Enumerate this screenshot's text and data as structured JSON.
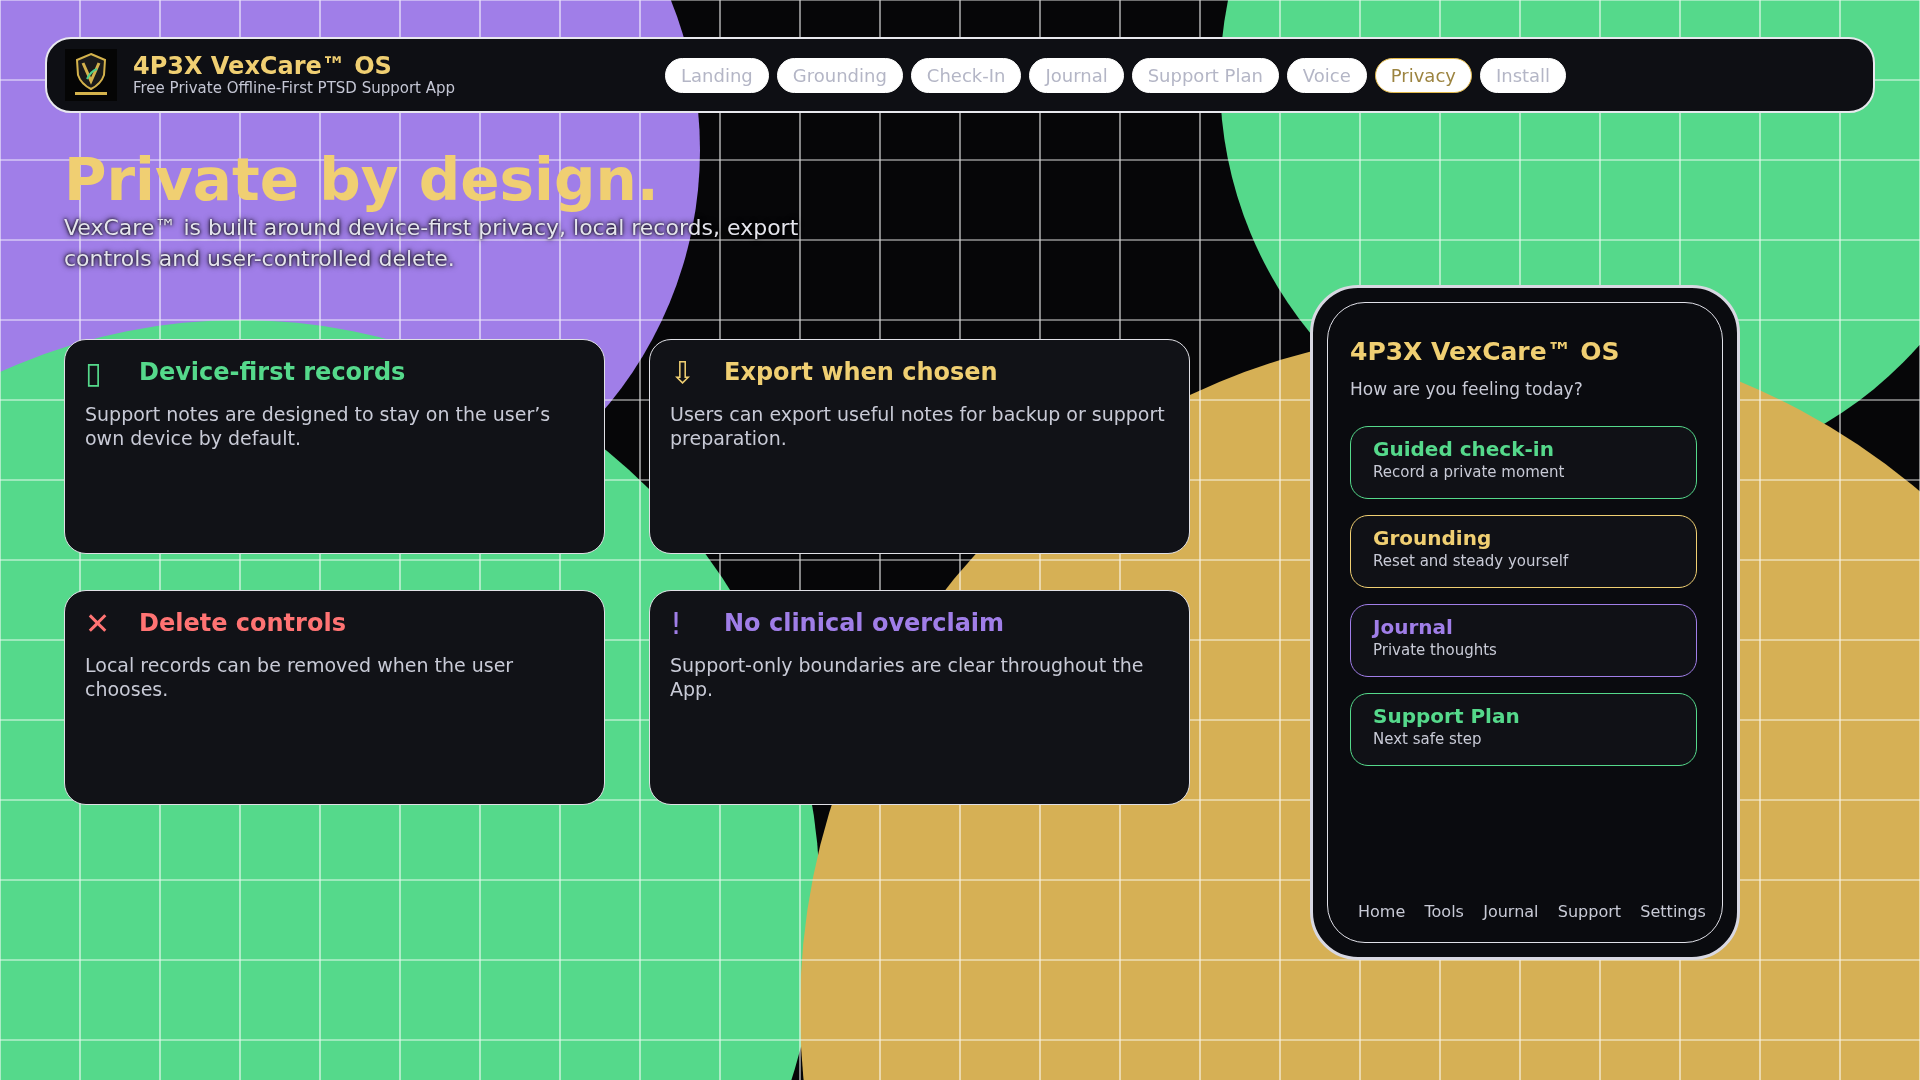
{
  "header": {
    "title": "4P3X VexCare™ OS",
    "subtitle": "Free Private Offline-First PTSD Support App"
  },
  "tabs": [
    {
      "label": "Landing",
      "selected": false
    },
    {
      "label": "Grounding",
      "selected": false
    },
    {
      "label": "Check-In",
      "selected": false
    },
    {
      "label": "Journal",
      "selected": false
    },
    {
      "label": "Support Plan",
      "selected": false
    },
    {
      "label": "Voice",
      "selected": false
    },
    {
      "label": "Privacy",
      "selected": true
    },
    {
      "label": "Install",
      "selected": false
    }
  ],
  "hero": {
    "title": "Private by design.",
    "text": "VexCare™ is built around device-first privacy, local records, export controls and user-controlled delete."
  },
  "cards": [
    {
      "icon": "▯",
      "title": "Device-first records",
      "text": "Support notes are designed to stay on the user’s own device by default.",
      "color": "#55d98b"
    },
    {
      "icon": "⇩",
      "title": "Export when chosen",
      "text": "Users can export useful notes for backup or support preparation.",
      "color": "#f0cf72"
    },
    {
      "icon": "✕",
      "title": "Delete controls",
      "text": "Local records can be removed when the user chooses.",
      "color": "#ff7373"
    },
    {
      "icon": "!",
      "title": "No clinical overclaim",
      "text": "Support-only boundaries are clear throughout the App.",
      "color": "#a07ee8"
    }
  ],
  "phone": {
    "title": "4P3X VexCare™ OS",
    "prompt": "How are you feeling today?",
    "items": [
      {
        "title": "Guided check-in",
        "text": "Record a private moment",
        "color": "#55d98b"
      },
      {
        "title": "Grounding",
        "text": "Reset and steady yourself",
        "color": "#f0cf72"
      },
      {
        "title": "Journal",
        "text": "Private thoughts",
        "color": "#a07ee8"
      },
      {
        "title": "Support Plan",
        "text": "Next safe step",
        "color": "#55d98b"
      }
    ],
    "nav": [
      "Home",
      "Tools",
      "Journal",
      "Support",
      "Settings"
    ]
  }
}
